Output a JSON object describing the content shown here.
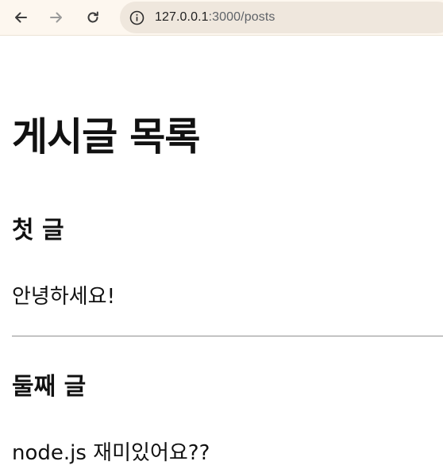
{
  "browser": {
    "url_host": "127.0.0.1",
    "url_path": ":3000/posts",
    "icons": {
      "back": "back-arrow-icon",
      "forward": "forward-arrow-icon",
      "reload": "reload-icon",
      "info": "site-info-icon"
    }
  },
  "page": {
    "title": "게시글 목록"
  },
  "posts": [
    {
      "title": "첫 글",
      "body": "안녕하세요!"
    },
    {
      "title": "둘째 글",
      "body": "node.js 재미있어요??"
    }
  ],
  "colors": {
    "toolbar_bg": "#fdf7ef",
    "omnibox_bg": "#efe7dd",
    "divider": "#8f8f8f",
    "text": "#111111"
  }
}
